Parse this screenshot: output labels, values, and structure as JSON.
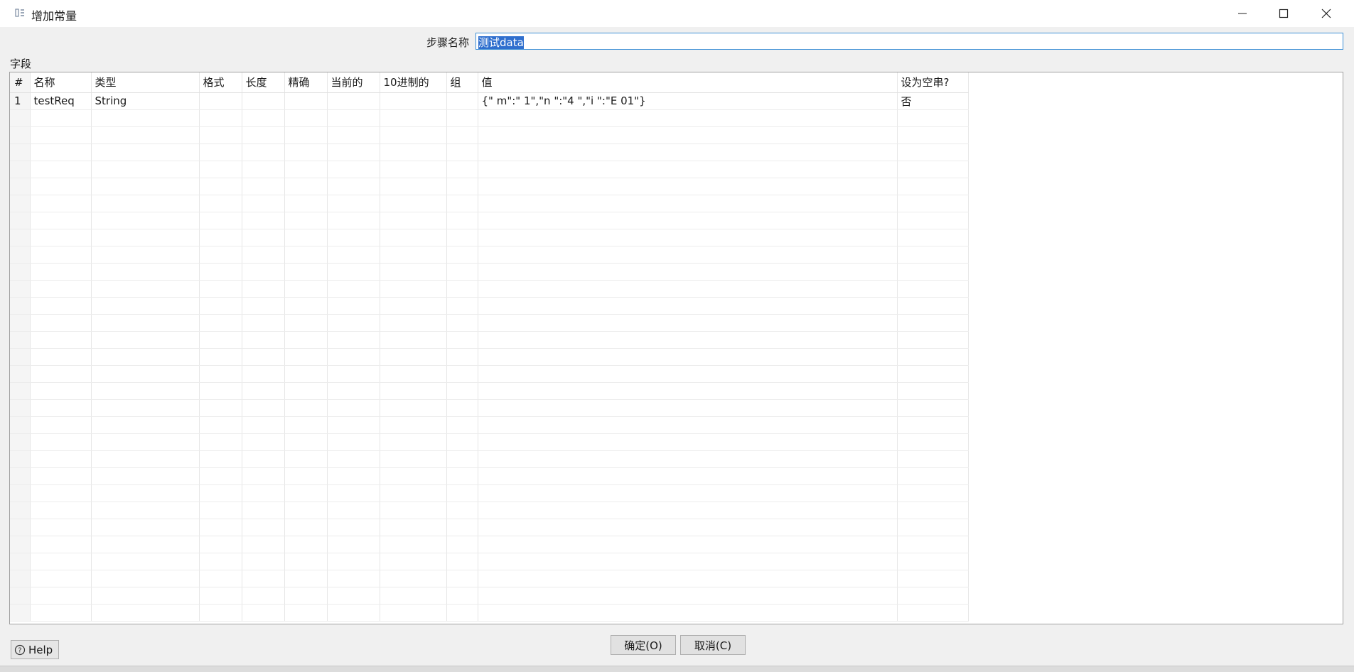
{
  "window": {
    "title": "增加常量"
  },
  "step": {
    "label": "步骤名称",
    "value": "测试data"
  },
  "fields": {
    "label": "字段",
    "columns": [
      "#",
      "名称",
      "类型",
      "格式",
      "长度",
      "精确",
      "当前的",
      "10进制的",
      "组",
      "值",
      "设为空串?"
    ],
    "rows": [
      {
        "num": "1",
        "name": "testReq",
        "type": "String",
        "format": "",
        "length": "",
        "precision": "",
        "currency": "",
        "decimal": "",
        "group": "",
        "value": "{\"       m\":\"        1\",\"n          \":\"4          \",\"i       \":\"E              01\"}",
        "empty": "否"
      }
    ]
  },
  "buttons": {
    "ok": "确定(O)",
    "cancel": "取消(C)",
    "help": "Help"
  }
}
